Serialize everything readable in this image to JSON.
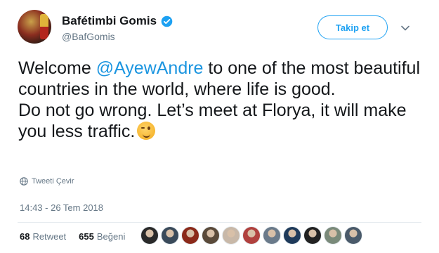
{
  "user": {
    "display_name": "Bafétimbi Gomis",
    "handle": "@BafGomis",
    "verified_icon": "verified-badge-icon",
    "avatar_icon": "profile-avatar"
  },
  "header": {
    "follow_label": "Takip et",
    "menu_icon": "chevron-down-icon"
  },
  "tweet": {
    "line1_pre": "Welcome ",
    "mention": "@AyewAndre",
    "line1_post": " to one of the most beautiful countries in the world, where life is good.",
    "line2": "Do not go wrong. Let’s meet at Florya, it will make you less traffic.",
    "emoji": "winking-face-emoji"
  },
  "translate": {
    "label": "Tweeti Çevir",
    "icon": "globe-icon"
  },
  "timestamp": "14:43 - 26 Tem 2018",
  "stats": {
    "retweets_count": "68",
    "retweets_label": "Retweet",
    "likes_count": "655",
    "likes_label": "Beğeni"
  },
  "likers": {
    "colors": [
      "#2a2a2a",
      "#3a4a5a",
      "#8b2a1a",
      "#5a4a3a",
      "#c8b8a8",
      "#b0413e",
      "#6a7a8a",
      "#1e3a5a",
      "#222222",
      "#7a8a7a",
      "#4a5a6a"
    ]
  }
}
